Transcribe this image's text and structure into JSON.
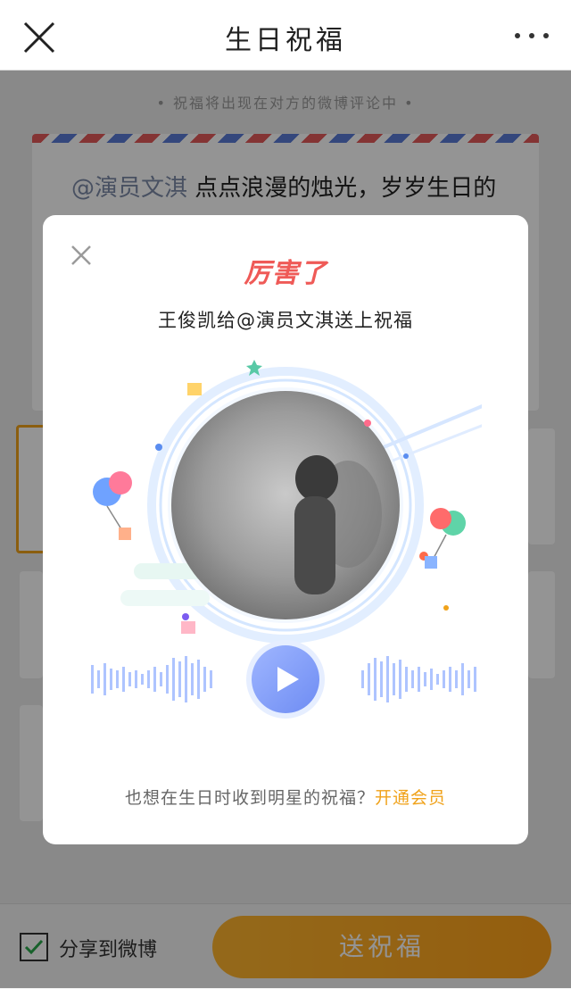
{
  "header": {
    "title": "生日祝福"
  },
  "hint": "• 祝福将出现在对方的微博评论中 •",
  "message": {
    "mention": "@演员文淇",
    "text": "点点浪漫的烛光，岁岁生日的"
  },
  "bottom": {
    "share_label": "分享到微博",
    "send_label": "送祝福"
  },
  "modal": {
    "badge_text": "厉害了",
    "subtitle": "王俊凯给@演员文淇送上祝福",
    "footer_prefix": "也想在生日时收到明星的祝福？",
    "footer_cta": "开通会员"
  },
  "colors": {
    "accent_orange": "#f0a21a",
    "badge_red": "#ef5a57",
    "play_blue": "#7e9bf7"
  },
  "icons": {
    "close": "close-icon",
    "more": "more-dots-icon",
    "play": "play-icon",
    "checkbox": "checkbox-checked-icon"
  }
}
